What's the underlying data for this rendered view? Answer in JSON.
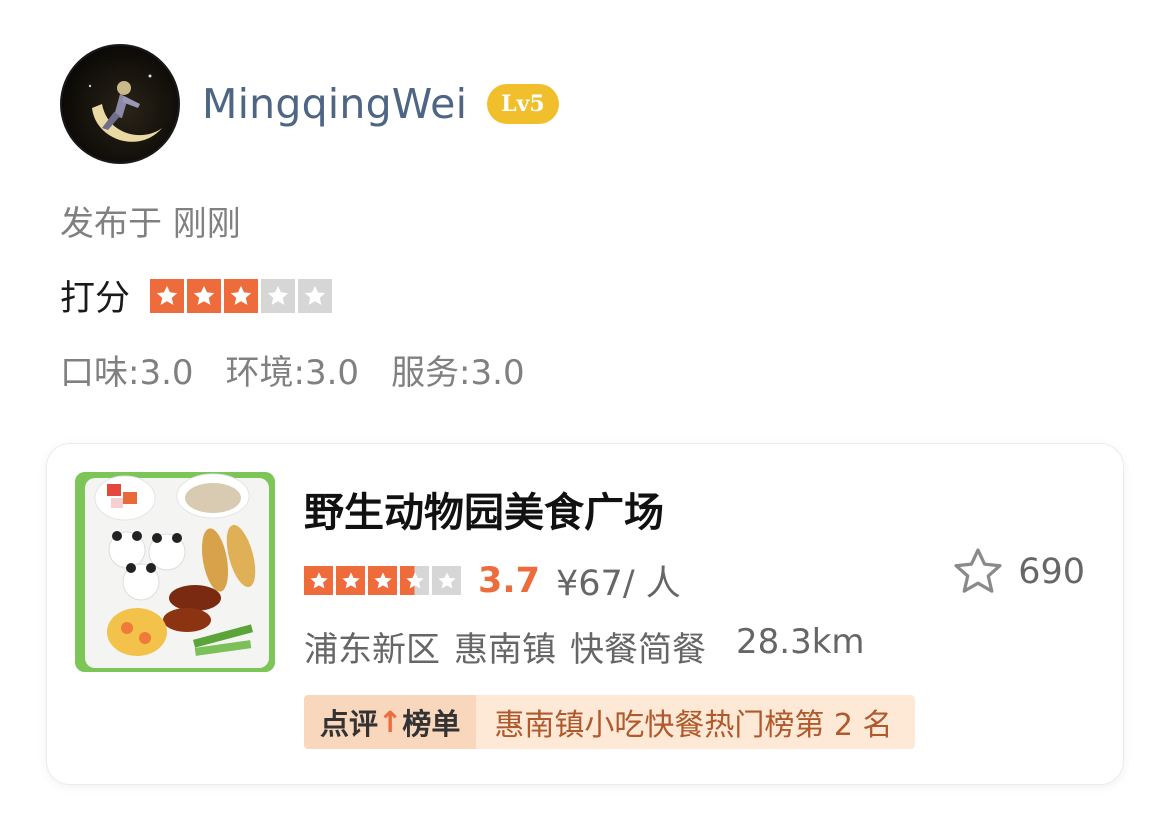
{
  "user": {
    "name": "MingqingWei",
    "level": "Lv5"
  },
  "publish": {
    "text": "发布于 刚刚"
  },
  "rating": {
    "label": "打分",
    "stars": 3,
    "max_stars": 5
  },
  "sub_scores": {
    "taste": "口味:3.0",
    "environment": "环境:3.0",
    "service": "服务:3.0"
  },
  "shop": {
    "name": "野生动物园美食广场",
    "stars": 3.5,
    "score": "3.7",
    "price": "¥67/ 人",
    "favorites": "690",
    "district": "浦东新区",
    "town": "惠南镇",
    "category": "快餐简餐",
    "distance": "28.3km",
    "rank_label_pre": "点评",
    "rank_label_post": "榜单",
    "rank_text": "惠南镇小吃快餐热门榜第 2 名"
  },
  "colors": {
    "accent": "#ee6b3b",
    "username": "#4e6583",
    "level_badge": "#f1bf2c",
    "star_off": "#d6d6d6"
  },
  "icons": {
    "star": "star-icon",
    "favorite": "star-outline-icon"
  }
}
